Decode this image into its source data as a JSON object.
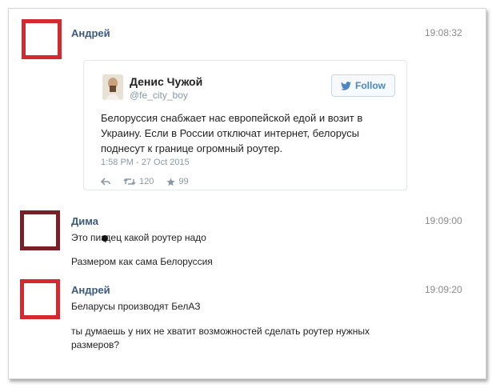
{
  "messages": [
    {
      "author": "Андрей",
      "time": "19:08:32",
      "avatar_color": "#d42a2f",
      "tweet": {
        "name": "Денис Чужой",
        "handle": "@fe_city_boy",
        "follow_label": "Follow",
        "text": "Белоруссия снабжает нас европейской едой и возит в Украину. Если в России отключат интернет, белорусы поднесут к границе огромный роутер.",
        "date": "1:58 PM - 27 Oct 2015",
        "retweets": "120",
        "likes": "99"
      }
    },
    {
      "author": "Дима",
      "time": "19:09:00",
      "avatar_color": "#7a1e28",
      "lines": [
        "Это пиздец какой роутер надо",
        "Размером как сама Белоруссия"
      ]
    },
    {
      "author": "Андрей",
      "time": "19:09:20",
      "avatar_color": "#d42a2f",
      "lines": [
        "Беларусы производят БелАЗ",
        "ты думаешь у них не хватит возможностей сделать роутер нужных размеров?"
      ]
    }
  ],
  "colors": {
    "name": "#3b5a80",
    "twitter_blue": "#4a86c5"
  }
}
